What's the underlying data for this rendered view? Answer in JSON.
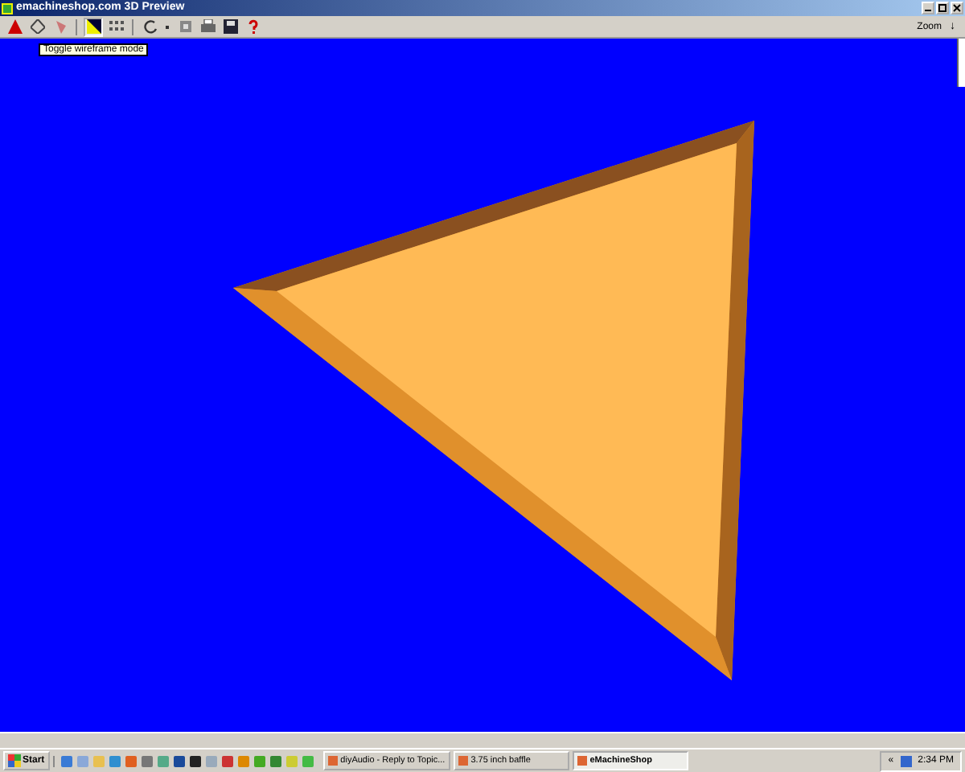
{
  "window": {
    "title": "emachineshop.com 3D Preview"
  },
  "toolbar": {
    "tooltip": "Toggle wireframe mode",
    "zoom_label": "Zoom",
    "zoom_arrow": "↓"
  },
  "taskbar": {
    "start": "Start",
    "tasks": [
      {
        "label": "diyAudio - Reply to Topic...",
        "selected": false
      },
      {
        "label": "3.75 inch baffle",
        "selected": false
      },
      {
        "label": "eMachineShop",
        "selected": true
      }
    ],
    "tray_arrow": "«",
    "clock": "2:34 PM"
  }
}
